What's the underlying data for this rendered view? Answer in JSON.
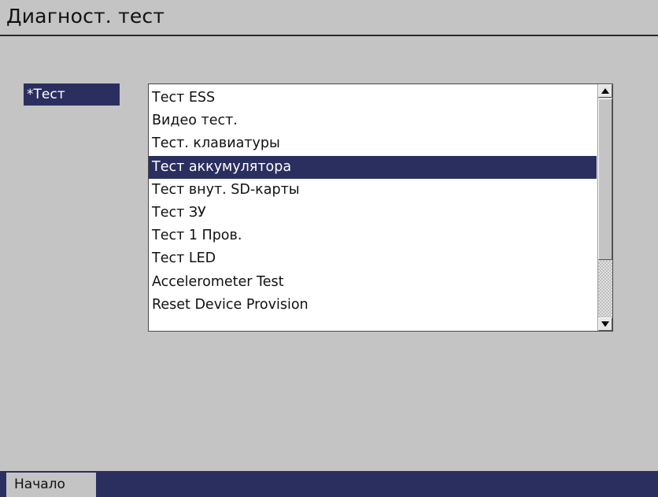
{
  "header": {
    "title": "Диагност. тест"
  },
  "field": {
    "label": "*Тест"
  },
  "list": {
    "items": [
      "Тест ESS",
      "Видео тест.",
      "Тест. клавиатуры",
      "Тест аккумулятора",
      "Тест внут. SD-карты",
      "Тест ЗУ",
      "Тест 1 Пров.",
      "Тест LED",
      "Accelerometer Test",
      "Reset Device Provision"
    ],
    "selected_index": 3
  },
  "footer": {
    "start_label": "Начало"
  },
  "colors": {
    "background": "#c4c4c4",
    "accent": "#2b2f5f",
    "list_background": "#ffffff"
  },
  "icons": {
    "scroll_up": "scroll-up-arrow-icon",
    "scroll_down": "scroll-down-arrow-icon"
  }
}
